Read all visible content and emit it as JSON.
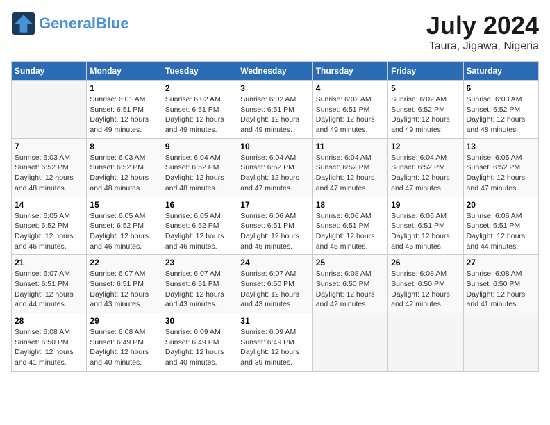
{
  "header": {
    "logo_line1": "General",
    "logo_line2": "Blue",
    "title": "July 2024",
    "subtitle": "Taura, Jigawa, Nigeria"
  },
  "weekdays": [
    "Sunday",
    "Monday",
    "Tuesday",
    "Wednesday",
    "Thursday",
    "Friday",
    "Saturday"
  ],
  "weeks": [
    [
      {
        "day": "",
        "info": ""
      },
      {
        "day": "1",
        "info": "Sunrise: 6:01 AM\nSunset: 6:51 PM\nDaylight: 12 hours\nand 49 minutes."
      },
      {
        "day": "2",
        "info": "Sunrise: 6:02 AM\nSunset: 6:51 PM\nDaylight: 12 hours\nand 49 minutes."
      },
      {
        "day": "3",
        "info": "Sunrise: 6:02 AM\nSunset: 6:51 PM\nDaylight: 12 hours\nand 49 minutes."
      },
      {
        "day": "4",
        "info": "Sunrise: 6:02 AM\nSunset: 6:51 PM\nDaylight: 12 hours\nand 49 minutes."
      },
      {
        "day": "5",
        "info": "Sunrise: 6:02 AM\nSunset: 6:52 PM\nDaylight: 12 hours\nand 49 minutes."
      },
      {
        "day": "6",
        "info": "Sunrise: 6:03 AM\nSunset: 6:52 PM\nDaylight: 12 hours\nand 48 minutes."
      }
    ],
    [
      {
        "day": "7",
        "info": "Sunrise: 6:03 AM\nSunset: 6:52 PM\nDaylight: 12 hours\nand 48 minutes."
      },
      {
        "day": "8",
        "info": "Sunrise: 6:03 AM\nSunset: 6:52 PM\nDaylight: 12 hours\nand 48 minutes."
      },
      {
        "day": "9",
        "info": "Sunrise: 6:04 AM\nSunset: 6:52 PM\nDaylight: 12 hours\nand 48 minutes."
      },
      {
        "day": "10",
        "info": "Sunrise: 6:04 AM\nSunset: 6:52 PM\nDaylight: 12 hours\nand 47 minutes."
      },
      {
        "day": "11",
        "info": "Sunrise: 6:04 AM\nSunset: 6:52 PM\nDaylight: 12 hours\nand 47 minutes."
      },
      {
        "day": "12",
        "info": "Sunrise: 6:04 AM\nSunset: 6:52 PM\nDaylight: 12 hours\nand 47 minutes."
      },
      {
        "day": "13",
        "info": "Sunrise: 6:05 AM\nSunset: 6:52 PM\nDaylight: 12 hours\nand 47 minutes."
      }
    ],
    [
      {
        "day": "14",
        "info": "Sunrise: 6:05 AM\nSunset: 6:52 PM\nDaylight: 12 hours\nand 46 minutes."
      },
      {
        "day": "15",
        "info": "Sunrise: 6:05 AM\nSunset: 6:52 PM\nDaylight: 12 hours\nand 46 minutes."
      },
      {
        "day": "16",
        "info": "Sunrise: 6:05 AM\nSunset: 6:52 PM\nDaylight: 12 hours\nand 46 minutes."
      },
      {
        "day": "17",
        "info": "Sunrise: 6:06 AM\nSunset: 6:51 PM\nDaylight: 12 hours\nand 45 minutes."
      },
      {
        "day": "18",
        "info": "Sunrise: 6:06 AM\nSunset: 6:51 PM\nDaylight: 12 hours\nand 45 minutes."
      },
      {
        "day": "19",
        "info": "Sunrise: 6:06 AM\nSunset: 6:51 PM\nDaylight: 12 hours\nand 45 minutes."
      },
      {
        "day": "20",
        "info": "Sunrise: 6:06 AM\nSunset: 6:51 PM\nDaylight: 12 hours\nand 44 minutes."
      }
    ],
    [
      {
        "day": "21",
        "info": "Sunrise: 6:07 AM\nSunset: 6:51 PM\nDaylight: 12 hours\nand 44 minutes."
      },
      {
        "day": "22",
        "info": "Sunrise: 6:07 AM\nSunset: 6:51 PM\nDaylight: 12 hours\nand 43 minutes."
      },
      {
        "day": "23",
        "info": "Sunrise: 6:07 AM\nSunset: 6:51 PM\nDaylight: 12 hours\nand 43 minutes."
      },
      {
        "day": "24",
        "info": "Sunrise: 6:07 AM\nSunset: 6:50 PM\nDaylight: 12 hours\nand 43 minutes."
      },
      {
        "day": "25",
        "info": "Sunrise: 6:08 AM\nSunset: 6:50 PM\nDaylight: 12 hours\nand 42 minutes."
      },
      {
        "day": "26",
        "info": "Sunrise: 6:08 AM\nSunset: 6:50 PM\nDaylight: 12 hours\nand 42 minutes."
      },
      {
        "day": "27",
        "info": "Sunrise: 6:08 AM\nSunset: 6:50 PM\nDaylight: 12 hours\nand 41 minutes."
      }
    ],
    [
      {
        "day": "28",
        "info": "Sunrise: 6:08 AM\nSunset: 6:50 PM\nDaylight: 12 hours\nand 41 minutes."
      },
      {
        "day": "29",
        "info": "Sunrise: 6:08 AM\nSunset: 6:49 PM\nDaylight: 12 hours\nand 40 minutes."
      },
      {
        "day": "30",
        "info": "Sunrise: 6:09 AM\nSunset: 6:49 PM\nDaylight: 12 hours\nand 40 minutes."
      },
      {
        "day": "31",
        "info": "Sunrise: 6:09 AM\nSunset: 6:49 PM\nDaylight: 12 hours\nand 39 minutes."
      },
      {
        "day": "",
        "info": ""
      },
      {
        "day": "",
        "info": ""
      },
      {
        "day": "",
        "info": ""
      }
    ]
  ]
}
